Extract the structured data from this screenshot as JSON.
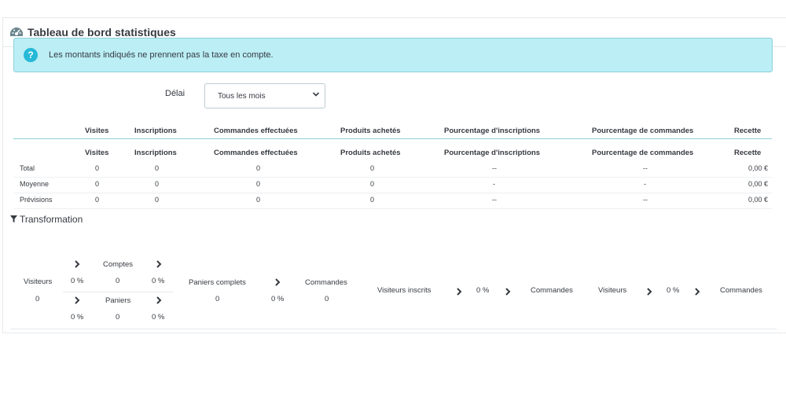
{
  "panel": {
    "title": "Tableau de bord statistiques",
    "icon": "dashboard-icon"
  },
  "alert": {
    "message": "Les montants indiqués ne prennent pas la taxe en compte.",
    "icon": "question-circle-icon"
  },
  "filter": {
    "label": "Délai",
    "selected": "Tous les mois"
  },
  "table": {
    "headers": [
      "Visites",
      "Inscriptions",
      "Commandes effectuées",
      "Produits achetés",
      "Pourcentage d'inscriptions",
      "Pourcentage de commandes",
      "Recette"
    ],
    "rows": [
      {
        "label": "Total",
        "cells": [
          "0",
          "0",
          "0",
          "0",
          "--",
          "--",
          "0,00 €"
        ]
      },
      {
        "label": "Moyenne",
        "cells": [
          "0",
          "0",
          "0",
          "0",
          "-",
          "-",
          "0,00 €"
        ]
      },
      {
        "label": "Prévisions",
        "cells": [
          "0",
          "0",
          "0",
          "0",
          "--",
          "--",
          "0,00 €"
        ]
      }
    ]
  },
  "transformation": {
    "title": "Transformation",
    "visitors_label": "Visiteurs",
    "visitors_value": "0",
    "top": {
      "pct1": "0 %",
      "label": "Comptes",
      "value": "0",
      "pct2": "0 %"
    },
    "bottom": {
      "pct1": "0 %",
      "label": "Paniers",
      "value": "0",
      "pct2": "0 %"
    },
    "full_carts": {
      "label": "Paniers complets",
      "value": "0"
    },
    "pct_orders": "0 %",
    "orders": {
      "label": "Commandes",
      "value": "0"
    },
    "registered": {
      "label": "Visiteurs inscrits",
      "pct": "0 %",
      "orders_label": "Commandes"
    },
    "visitors2": {
      "label": "Visiteurs",
      "pct": "0 %",
      "orders_label": "Commandes"
    }
  }
}
